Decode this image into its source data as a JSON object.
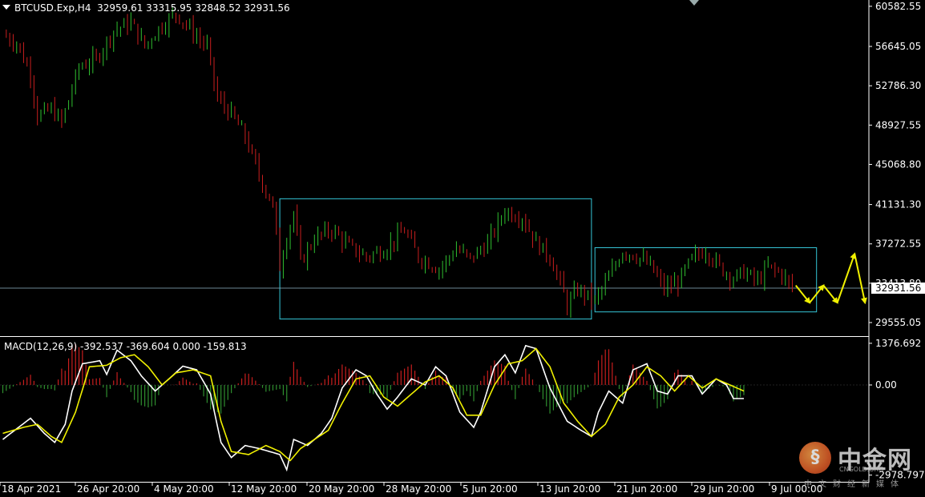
{
  "header": {
    "symbol": "BTCUSD.Exp,H4",
    "ohlc": "32959.61 33315.95 32848.52 32931.56"
  },
  "macd_header": {
    "label": "MACD(12,26,9) -392.537 -369.604 0.000 -159.813"
  },
  "watermark": {
    "logo_glyph": "§",
    "title": "中金网",
    "subtitle": "CNGOLD.ORG",
    "tagline": "中文财经新媒体"
  },
  "colors": {
    "background": "#000000",
    "bull": "#2fbf2f",
    "bear": "#c81e1e",
    "box": "#35c6d8",
    "arrows": "#f0f000",
    "macd_line": "#ffffff",
    "signal_line": "#f0f000",
    "hist_pos": "#c81e1e",
    "hist_neg": "#2f8f2f"
  },
  "chart_data": [
    {
      "type": "candlestick",
      "x_labels": [
        "18 Apr 2021",
        "26 Apr 20:00",
        "4 May 20:00",
        "12 May 20:00",
        "20 May 20:00",
        "28 May 20:00",
        "5 Jun 20:00",
        "13 Jun 20:00",
        "21 Jun 20:00",
        "29 Jun 20:00",
        "9 Jul 00:00"
      ],
      "y_ticks": [
        60582.55,
        56645.05,
        52786.3,
        48927.55,
        45068.8,
        41131.3,
        37272.55,
        33413.8,
        29555.05
      ],
      "y_tick_labels": [
        "60582.55",
        "56645.05",
        "52786.30",
        "48927.55",
        "45068.80",
        "41131.30",
        "37272.55",
        "33413.80",
        "29555.05"
      ],
      "ylim": [
        28300,
        61200
      ],
      "current_price": 32931.56,
      "current_price_label": "32931.56",
      "close_path": [
        [
          0,
          57800
        ],
        [
          4,
          57000
        ],
        [
          8,
          54000
        ],
        [
          10,
          49800
        ],
        [
          14,
          50500
        ],
        [
          17,
          49200
        ],
        [
          22,
          54600
        ],
        [
          27,
          55400
        ],
        [
          32,
          58200
        ],
        [
          37,
          59000
        ],
        [
          41,
          56700
        ],
        [
          45,
          58400
        ],
        [
          50,
          59900
        ],
        [
          55,
          58000
        ],
        [
          59,
          56600
        ],
        [
          62,
          51500
        ],
        [
          66,
          50000
        ],
        [
          70,
          47800
        ],
        [
          74,
          44000
        ],
        [
          78,
          41000
        ],
        [
          80,
          35000
        ],
        [
          82,
          38000
        ],
        [
          84,
          40300
        ],
        [
          86,
          35500
        ],
        [
          90,
          37800
        ],
        [
          95,
          38700
        ],
        [
          100,
          37000
        ],
        [
          105,
          36000
        ],
        [
          110,
          36700
        ],
        [
          116,
          38600
        ],
        [
          120,
          36000
        ],
        [
          126,
          34800
        ],
        [
          131,
          36800
        ],
        [
          135,
          35800
        ],
        [
          140,
          37300
        ],
        [
          145,
          40500
        ],
        [
          150,
          39900
        ],
        [
          154,
          37400
        ],
        [
          158,
          36000
        ],
        [
          161,
          33400
        ],
        [
          163,
          31200
        ],
        [
          166,
          32800
        ],
        [
          171,
          31700
        ],
        [
          175,
          33900
        ],
        [
          179,
          36600
        ],
        [
          183,
          36100
        ],
        [
          187,
          35100
        ],
        [
          191,
          32900
        ],
        [
          195,
          33500
        ],
        [
          199,
          35800
        ],
        [
          203,
          36700
        ],
        [
          207,
          35000
        ],
        [
          211,
          33900
        ],
        [
          214,
          34500
        ],
        [
          218,
          33600
        ],
        [
          221,
          35000
        ],
        [
          225,
          34300
        ],
        [
          228,
          32900
        ]
      ],
      "range_boxes": [
        {
          "start_index": 80,
          "end_index": 170,
          "low": 29900,
          "high": 41700
        },
        {
          "start_index": 171,
          "end_index": 235,
          "low": 30600,
          "high": 36900
        }
      ],
      "projection_path": [
        [
          229,
          33200
        ],
        [
          233,
          31500
        ],
        [
          237,
          33200
        ],
        [
          241,
          31500
        ],
        [
          246,
          36300
        ],
        [
          249,
          31500
        ]
      ]
    },
    {
      "type": "line",
      "name": "MACD(12,26,9)",
      "y_ticks": [
        1376.692,
        0.0,
        -2978.797
      ],
      "y_tick_labels": [
        "1376.692",
        "0.00",
        "-2978.797"
      ],
      "ylim": [
        -3200,
        1560
      ],
      "series": [
        {
          "role": "macd",
          "points": [
            [
              0,
              -1800
            ],
            [
              8,
              -1100
            ],
            [
              12,
              -1600
            ],
            [
              15,
              -1900
            ],
            [
              18,
              -1300
            ],
            [
              20,
              -200
            ],
            [
              23,
              700
            ],
            [
              28,
              800
            ],
            [
              30,
              350
            ],
            [
              33,
              1150
            ],
            [
              37,
              800
            ],
            [
              40,
              300
            ],
            [
              44,
              -200
            ],
            [
              48,
              200
            ],
            [
              52,
              620
            ],
            [
              56,
              500
            ],
            [
              60,
              -300
            ],
            [
              63,
              -1900
            ],
            [
              66,
              -2400
            ],
            [
              70,
              -2000
            ],
            [
              74,
              -2100
            ],
            [
              77,
              -2200
            ],
            [
              80,
              -2300
            ],
            [
              82,
              -2800
            ],
            [
              84,
              -1800
            ],
            [
              88,
              -2000
            ],
            [
              92,
              -1600
            ],
            [
              95,
              -1100
            ],
            [
              98,
              -100
            ],
            [
              102,
              500
            ],
            [
              105,
              300
            ],
            [
              108,
              -300
            ],
            [
              111,
              -800
            ],
            [
              114,
              -400
            ],
            [
              118,
              200
            ],
            [
              122,
              0
            ],
            [
              125,
              600
            ],
            [
              128,
              300
            ],
            [
              132,
              -900
            ],
            [
              136,
              -1400
            ],
            [
              138,
              -900
            ],
            [
              142,
              600
            ],
            [
              145,
              1000
            ],
            [
              148,
              400
            ],
            [
              151,
              1300
            ],
            [
              154,
              1200
            ],
            [
              158,
              -100
            ],
            [
              163,
              -1200
            ],
            [
              167,
              -1500
            ],
            [
              170,
              -1700
            ],
            [
              172,
              -900
            ],
            [
              175,
              -200
            ],
            [
              179,
              -600
            ],
            [
              182,
              500
            ],
            [
              186,
              700
            ],
            [
              189,
              -200
            ],
            [
              192,
              -300
            ],
            [
              195,
              300
            ],
            [
              199,
              300
            ],
            [
              202,
              -300
            ],
            [
              206,
              200
            ],
            [
              209,
              0
            ],
            [
              211,
              -450
            ],
            [
              214,
              -450
            ]
          ]
        },
        {
          "role": "signal",
          "points": [
            [
              0,
              -1600
            ],
            [
              6,
              -1400
            ],
            [
              10,
              -1300
            ],
            [
              14,
              -1700
            ],
            [
              17,
              -1900
            ],
            [
              21,
              -900
            ],
            [
              25,
              600
            ],
            [
              30,
              650
            ],
            [
              34,
              900
            ],
            [
              38,
              1000
            ],
            [
              42,
              600
            ],
            [
              46,
              0
            ],
            [
              50,
              400
            ],
            [
              55,
              500
            ],
            [
              60,
              300
            ],
            [
              63,
              -1200
            ],
            [
              66,
              -2200
            ],
            [
              71,
              -2300
            ],
            [
              76,
              -2000
            ],
            [
              80,
              -2200
            ],
            [
              83,
              -2500
            ],
            [
              86,
              -2100
            ],
            [
              90,
              -1800
            ],
            [
              94,
              -1500
            ],
            [
              98,
              -600
            ],
            [
              102,
              200
            ],
            [
              106,
              300
            ],
            [
              110,
              -400
            ],
            [
              114,
              -700
            ],
            [
              118,
              -300
            ],
            [
              122,
              100
            ],
            [
              126,
              300
            ],
            [
              130,
              -100
            ],
            [
              134,
              -1000
            ],
            [
              138,
              -1000
            ],
            [
              142,
              0
            ],
            [
              146,
              700
            ],
            [
              150,
              800
            ],
            [
              154,
              1200
            ],
            [
              158,
              600
            ],
            [
              162,
              -600
            ],
            [
              166,
              -1200
            ],
            [
              170,
              -1700
            ],
            [
              174,
              -1300
            ],
            [
              178,
              -400
            ],
            [
              182,
              0
            ],
            [
              186,
              600
            ],
            [
              190,
              300
            ],
            [
              194,
              -200
            ],
            [
              198,
              300
            ],
            [
              202,
              -100
            ],
            [
              206,
              200
            ],
            [
              210,
              0
            ],
            [
              214,
              -200
            ]
          ]
        }
      ]
    }
  ]
}
